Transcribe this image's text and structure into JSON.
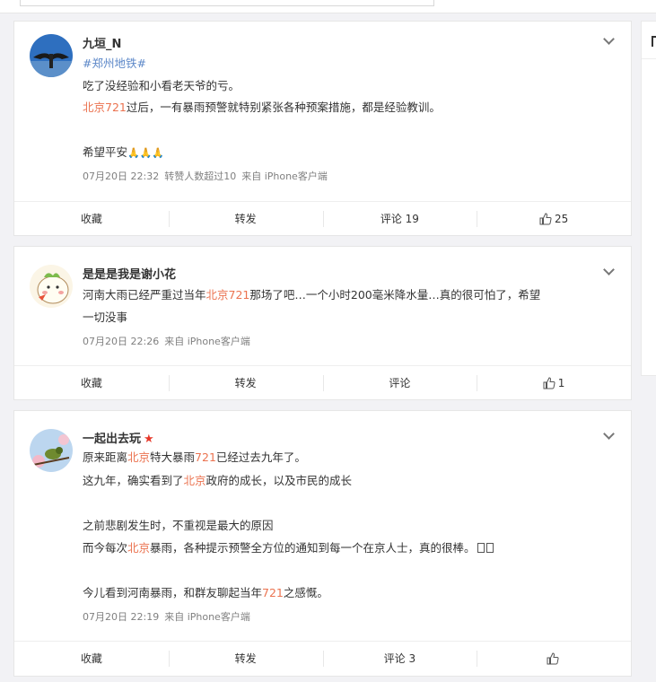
{
  "posts": [
    {
      "username": "九垣_N",
      "topic": "#郑州地铁#",
      "lines": [
        [
          {
            "t": "吃了没经验和小看老天爷的亏。",
            "hl": false
          }
        ],
        [
          {
            "t": "北京721",
            "hl": true
          },
          {
            "t": "过后，一有暴雨预警就特别紧张各种预案措施，都是经验教训。",
            "hl": false
          }
        ],
        [
          {
            "t": "希望平安",
            "hl": false
          },
          {
            "t": "🙏🙏🙏",
            "hl": false
          }
        ]
      ],
      "meta": {
        "time": "07月20日 22:32",
        "extra": "转赞人数超过10",
        "source": "来自 iPhone客户端"
      },
      "actions": {
        "favorite": "收藏",
        "repost": "转发",
        "comment": "评论 19",
        "like": "25"
      }
    },
    {
      "username": "是是是我是谢小花",
      "lines": [
        [
          {
            "t": "河南大雨已经严重过当年",
            "hl": false
          },
          {
            "t": "北京721",
            "hl": true
          },
          {
            "t": "那场了吧…一个小时200毫米降水量…真的很可怕了，希望",
            "hl": false
          }
        ],
        [
          {
            "t": "一切没事",
            "hl": false
          }
        ]
      ],
      "meta": {
        "time": "07月20日 22:26",
        "source": "来自 iPhone客户端"
      },
      "actions": {
        "favorite": "收藏",
        "repost": "转发",
        "comment": "评论",
        "like": "1"
      }
    },
    {
      "username": "一起出去玩",
      "lines": [
        [
          {
            "t": "原来距离",
            "hl": false
          },
          {
            "t": "北京",
            "hl": true
          },
          {
            "t": "特大暴雨",
            "hl": false
          },
          {
            "t": "721",
            "hl": true
          },
          {
            "t": "已经过去九年了。",
            "hl": false
          }
        ],
        [
          {
            "t": "这九年，确实看到了",
            "hl": false
          },
          {
            "t": "北京",
            "hl": true
          },
          {
            "t": "政府的成长，以及市民的成长",
            "hl": false
          }
        ],
        [
          {
            "t": "之前悲剧发生时，不重视是最大的原因",
            "hl": false
          }
        ],
        [
          {
            "t": "而今每次",
            "hl": false
          },
          {
            "t": "北京",
            "hl": true
          },
          {
            "t": "暴雨，各种提示预警全方位的通知到每一个在京人士，真的很棒。",
            "hl": false
          }
        ],
        [
          {
            "t": "今儿看到河南暴雨，和群友聊起当年",
            "hl": false
          },
          {
            "t": "721",
            "hl": true
          },
          {
            "t": "之感慨。",
            "hl": false
          }
        ]
      ],
      "meta": {
        "time": "07月20日 22:19",
        "source": "来自 iPhone客户端"
      },
      "actions": {
        "favorite": "收藏",
        "repost": "转发",
        "comment": "评论 3",
        "like": ""
      }
    }
  ],
  "colors": {
    "highlight": "#eb7350",
    "topic": "#5b87c8",
    "vip": "#e6382a"
  }
}
